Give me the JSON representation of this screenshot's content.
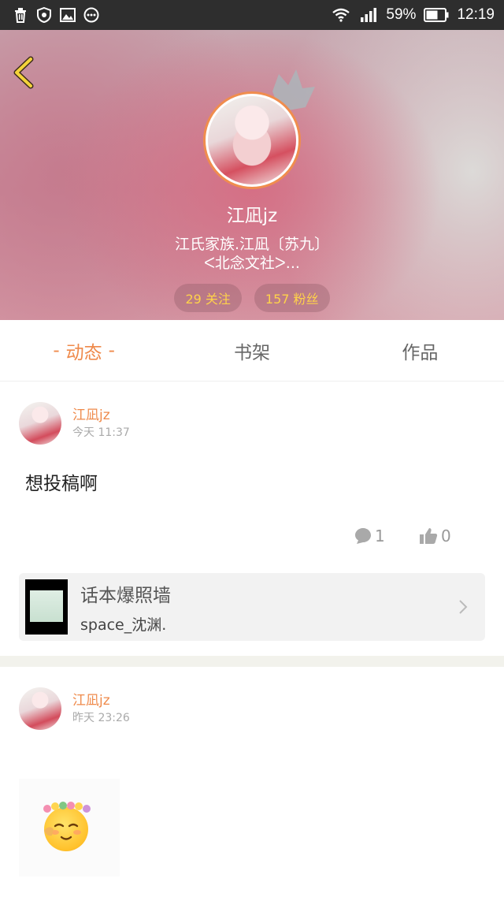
{
  "status_bar": {
    "battery": "59%",
    "time": "12:19",
    "icons_left": [
      "trash-icon",
      "shield-icon",
      "image-icon",
      "more-circle-icon"
    ],
    "icons_right": [
      "wifi-icon",
      "signal-icon",
      "battery-icon"
    ]
  },
  "profile": {
    "name": "江凪jz",
    "bio_line1": "江氏家族.江凪〔苏九〕",
    "bio_line2": "ᐸ北念文社ᐳ...",
    "following": "29 关注",
    "followers": "157 粉丝"
  },
  "tabs": {
    "active_prefix": "-",
    "active_suffix": "-",
    "items": [
      "动态",
      "书架",
      "作品"
    ]
  },
  "posts": [
    {
      "author": "江凪jz",
      "time": "今天 11:37",
      "text": "想投稿啊",
      "comments": "1",
      "likes": "0",
      "card": {
        "title": "话本爆照墙",
        "subtitle": "space_沈渊."
      }
    },
    {
      "author": "江凪jz",
      "time": "昨天 23:26"
    }
  ],
  "colors": {
    "accent": "#ef8a4b",
    "pill_text": "#ffd24a",
    "status_bar": "#2e2e2e"
  }
}
